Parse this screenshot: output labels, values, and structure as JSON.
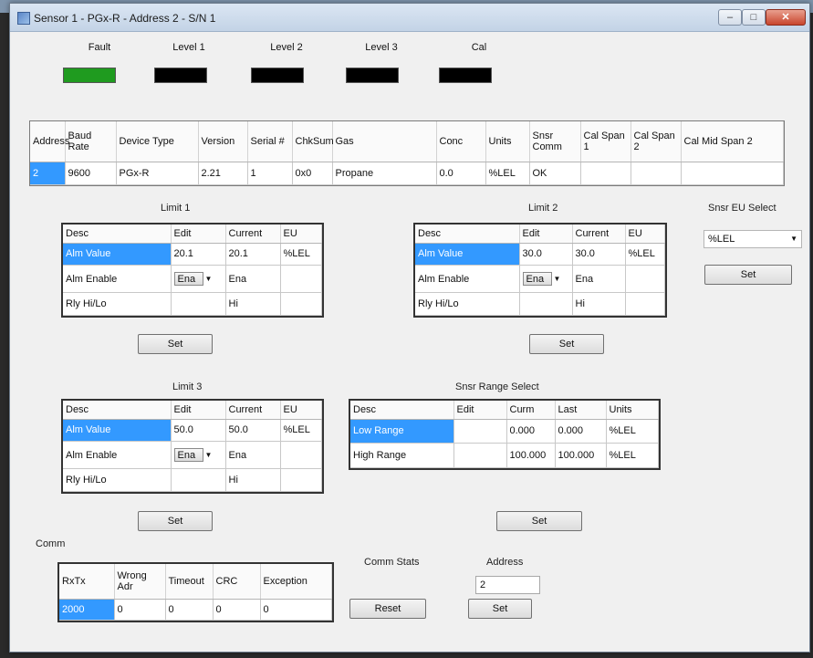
{
  "window": {
    "title": "Sensor 1 - PGx-R - Address 2 - S/N 1",
    "min_glyph": "–",
    "max_glyph": "□",
    "close_glyph": "✕"
  },
  "indicators": [
    {
      "label": "Fault",
      "color": "#1f9b1f"
    },
    {
      "label": "Level 1",
      "color": "#000000"
    },
    {
      "label": "Level 2",
      "color": "#000000"
    },
    {
      "label": "Level 3",
      "color": "#000000"
    },
    {
      "label": "Cal",
      "color": "#000000"
    }
  ],
  "device_table": {
    "headers": [
      "Address",
      "Baud Rate",
      "Device Type",
      "Version",
      "Serial #",
      "ChkSum",
      "Gas",
      "Conc",
      "Units",
      "Snsr Comm",
      "Cal Span 1",
      "Cal Span 2",
      "Cal Mid Span 2"
    ],
    "row": [
      "2",
      "9600",
      "PGx-R",
      "2.21",
      "1",
      "0x0",
      "Propane",
      "0.0",
      "%LEL",
      "OK",
      "",
      "",
      ""
    ]
  },
  "limit_headers": [
    "Desc",
    "Edit",
    "Current",
    "EU"
  ],
  "limit1": {
    "title": "Limit 1",
    "rows": [
      {
        "desc": "Alm Value",
        "edit": "20.1",
        "current": "20.1",
        "eu": "%LEL"
      },
      {
        "desc": "Alm Enable",
        "edit": "Ena",
        "current": "Ena",
        "eu": ""
      },
      {
        "desc": "Rly Hi/Lo",
        "edit": "",
        "current": "Hi",
        "eu": ""
      }
    ],
    "set_label": "Set"
  },
  "limit2": {
    "title": "Limit 2",
    "rows": [
      {
        "desc": "Alm Value",
        "edit": "30.0",
        "current": "30.0",
        "eu": "%LEL"
      },
      {
        "desc": "Alm Enable",
        "edit": "Ena",
        "current": "Ena",
        "eu": ""
      },
      {
        "desc": "Rly Hi/Lo",
        "edit": "",
        "current": "Hi",
        "eu": ""
      }
    ],
    "set_label": "Set"
  },
  "limit3": {
    "title": "Limit 3",
    "rows": [
      {
        "desc": "Alm Value",
        "edit": "50.0",
        "current": "50.0",
        "eu": "%LEL"
      },
      {
        "desc": "Alm Enable",
        "edit": "Ena",
        "current": "Ena",
        "eu": ""
      },
      {
        "desc": "Rly Hi/Lo",
        "edit": "",
        "current": "Hi",
        "eu": ""
      }
    ],
    "set_label": "Set"
  },
  "eu_select": {
    "title": "Snsr EU Select",
    "value": "%LEL",
    "set_label": "Set"
  },
  "range_select": {
    "title": "Snsr Range Select",
    "headers": [
      "Desc",
      "Edit",
      "Curm",
      "Last",
      "Units"
    ],
    "rows": [
      {
        "desc": "Low Range",
        "edit": "",
        "curr": "0.000",
        "last": "0.000",
        "units": "%LEL"
      },
      {
        "desc": "High Range",
        "edit": "",
        "curr": "100.000",
        "last": "100.000",
        "units": "%LEL"
      }
    ],
    "set_label": "Set"
  },
  "comm": {
    "title": "Comm",
    "headers": [
      "RxTx",
      "Wrong Adr",
      "Timeout",
      "CRC",
      "Exception"
    ],
    "row": [
      "2000",
      "0",
      "0",
      "0",
      "0"
    ]
  },
  "comm_stats": {
    "title": "Comm Stats",
    "reset_label": "Reset"
  },
  "address": {
    "title": "Address",
    "value": "2",
    "set_label": "Set"
  }
}
